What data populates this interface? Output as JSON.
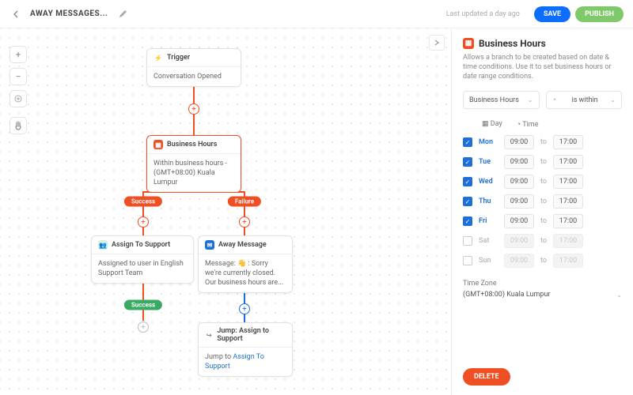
{
  "header": {
    "title": "AWAY MESSAGES...",
    "updated": "Last updated a day ago",
    "save": "SAVE",
    "publish": "PUBLISH"
  },
  "nodes": {
    "trigger": {
      "title": "Trigger",
      "body": "Conversation Opened"
    },
    "hours": {
      "title": "Business Hours",
      "body": "Within business hours - (GMT+08:00) Kuala Lumpur"
    },
    "assign": {
      "title": "Assign To Support",
      "body": "Assigned to user in English Support Team"
    },
    "away": {
      "title": "Away Message",
      "body": "Message: 👋 : Sorry we're currently closed. Our business hours are..."
    },
    "jump": {
      "title": "Jump: Assign to Support",
      "pre": "Jump to ",
      "link": "Assign To Support"
    }
  },
  "pills": {
    "success": "Success",
    "failure": "Failure"
  },
  "panel": {
    "title": "Business Hours",
    "desc": "Allows a branch to be created based on date & time conditions. Use it to set business hours or date range conditions.",
    "sel1": "Business Hours",
    "sel2": "is within",
    "dayh": "Day",
    "timeh": "Time",
    "to": "to",
    "days": [
      {
        "n": "Mon",
        "on": true,
        "a": "09:00",
        "b": "17:00"
      },
      {
        "n": "Tue",
        "on": true,
        "a": "09:00",
        "b": "17:00"
      },
      {
        "n": "Wed",
        "on": true,
        "a": "09:00",
        "b": "17:00"
      },
      {
        "n": "Thu",
        "on": true,
        "a": "09:00",
        "b": "17:00"
      },
      {
        "n": "Fri",
        "on": true,
        "a": "09:00",
        "b": "17:00"
      },
      {
        "n": "Sat",
        "on": false,
        "a": "09:00",
        "b": "17:00"
      },
      {
        "n": "Sun",
        "on": false,
        "a": "09:00",
        "b": "17:00"
      }
    ],
    "tzlabel": "Time Zone",
    "tz": "(GMT+08:00) Kuala Lumpur",
    "delete": "DELETE"
  }
}
